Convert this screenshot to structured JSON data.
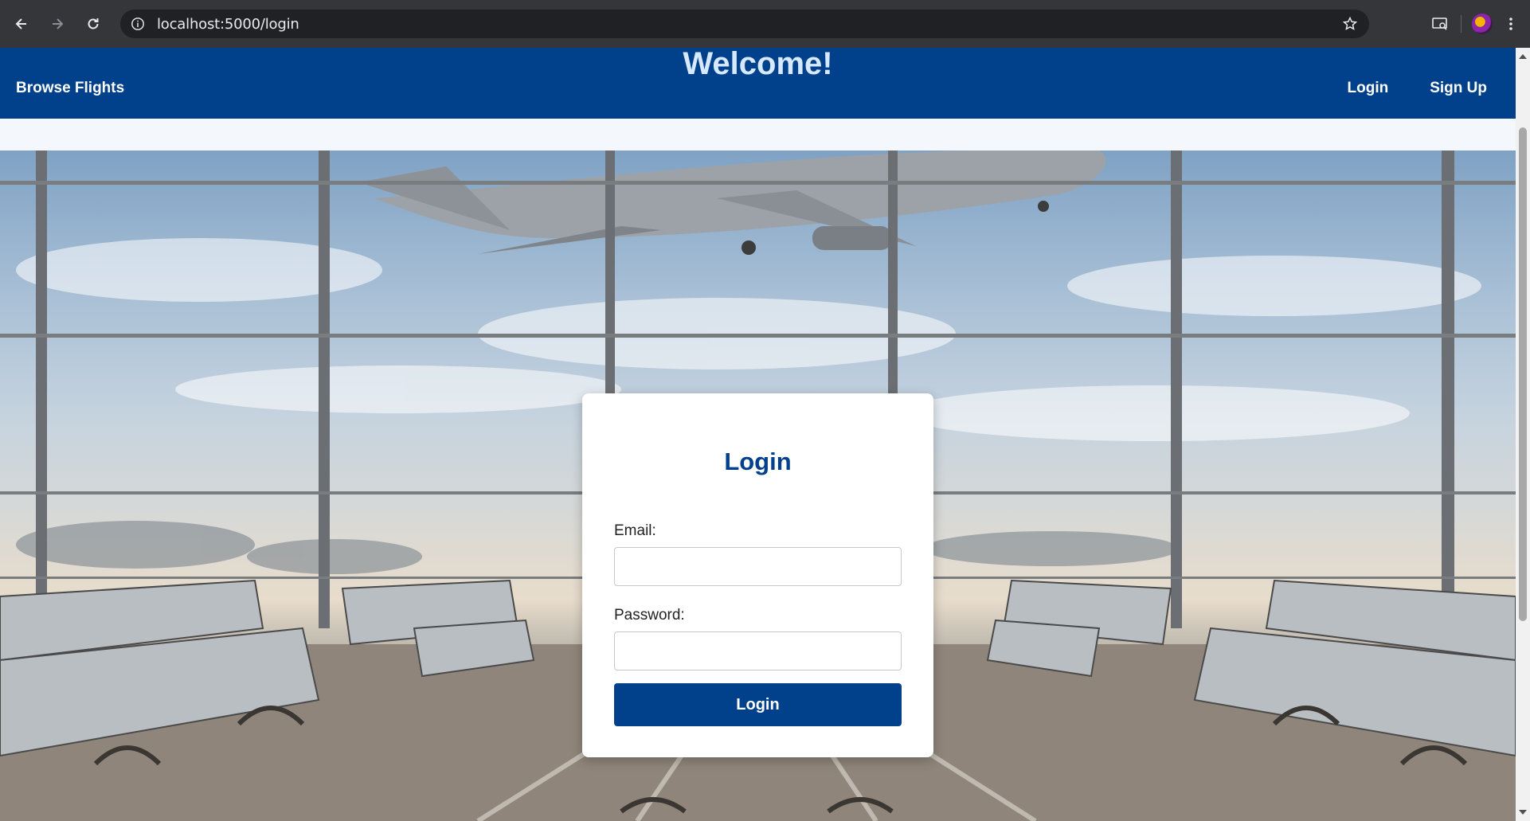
{
  "browser": {
    "url": "localhost:5000/login",
    "icons": [
      "back-icon",
      "forward-icon",
      "reload-icon",
      "site-info-icon",
      "bookmark-star-icon",
      "cast-icon",
      "profile-avatar",
      "kebab-menu-icon"
    ]
  },
  "header": {
    "brand_link": "Browse Flights",
    "welcome": "Welcome!",
    "login_link": "Login",
    "signup_link": "Sign Up"
  },
  "login_form": {
    "title": "Login",
    "email_label": "Email:",
    "email_value": "",
    "password_label": "Password:",
    "password_value": "",
    "submit_label": "Login"
  },
  "colors": {
    "header_bg": "#01408b",
    "welcome_text": "#d6e9ff",
    "button_bg": "#01408b",
    "card_bg": "#ffffff"
  }
}
